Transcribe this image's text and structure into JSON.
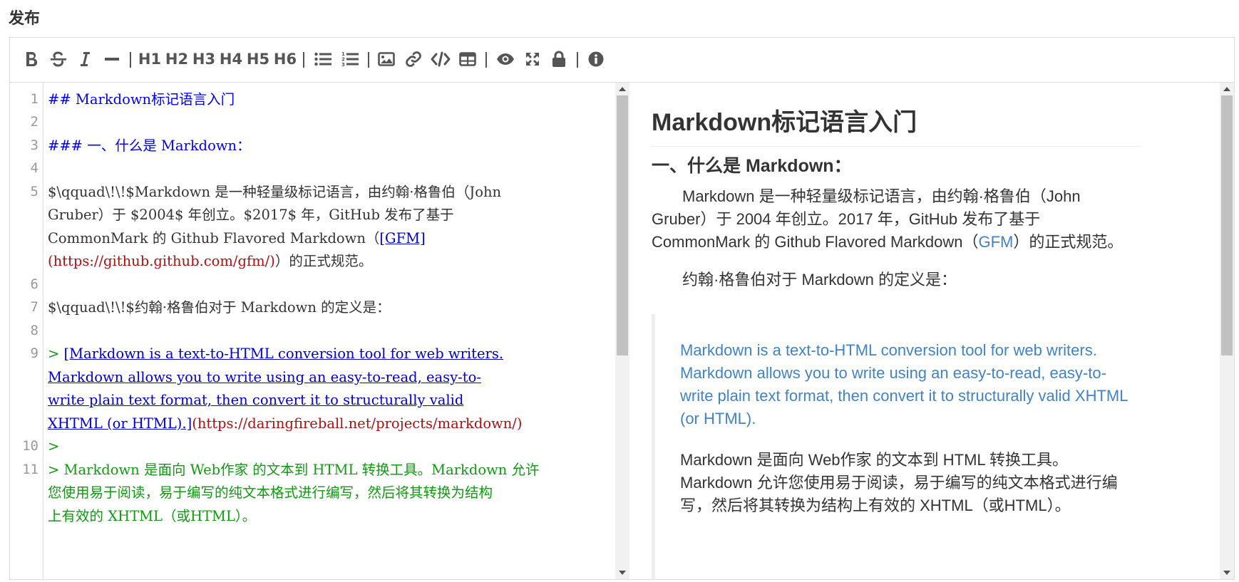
{
  "page": {
    "title": "发布"
  },
  "toolbar": {
    "headings": [
      "H1",
      "H2",
      "H3",
      "H4",
      "H5",
      "H6"
    ]
  },
  "icons": {
    "bold": "bold-icon",
    "strike": "strikethrough-icon",
    "italic": "italic-icon",
    "hr": "horizontal-rule-icon",
    "ul": "unordered-list-icon",
    "ol": "ordered-list-icon",
    "image": "image-icon",
    "link": "link-icon",
    "code": "code-icon",
    "table": "table-icon",
    "preview": "eye-icon",
    "fullscreen": "fullscreen-icon",
    "lock": "lock-icon",
    "info": "info-icon"
  },
  "code": {
    "line_numbers": [
      "1",
      "2",
      "3",
      "4",
      "5",
      "6",
      "7",
      "8",
      "9",
      "10",
      "11"
    ],
    "l1": "## Markdown标记语言入门",
    "l3": "### 一、什么是 Markdown：",
    "l5a": "$\\qquad\\!\\!$Markdown 是一种轻量级标记语言，由约翰·格鲁伯（John",
    "l5b": "Gruber）于 $2004$ 年创立。$2017$ 年，GitHub 发布了基于",
    "l5c_pre": "CommonMark 的 Github Flavored Markdown（",
    "l5c_link": "[GFM]",
    "l5d_url": "(https://github.github.com/gfm/)",
    "l5d_post": "）的正式规范。",
    "l7": "$\\qquad\\!\\!$约翰·格鲁伯对于 Markdown 的定义是：",
    "l9_prefix": "> ",
    "l9a": "[Markdown is a text-to-HTML conversion tool for web writers.",
    "l9b": "Markdown allows you to write using an easy-to-read, easy-to-",
    "l9c": "write plain text format, then convert it to structurally valid",
    "l9d_link": "XHTML (or HTML).]",
    "l9d_url": "(https://daringfireball.net/projects/markdown/)",
    "l10": ">",
    "l11a": "> Markdown 是面向 Web作家 的文本到 HTML 转换工具。Markdown 允许",
    "l11b": "您使用易于阅读，易于编写的纯文本格式进行编写，然后将其转换为结构",
    "l11c": "上有效的 XHTML（或HTML）。"
  },
  "preview": {
    "h2": "Markdown标记语言入门",
    "h3": "一、什么是 Markdown：",
    "p1a": "Markdown 是一种轻量级标记语言，由约翰·格鲁伯（John",
    "p1b": "Gruber）于 2004 年创立。2017 年，GitHub 发布了基于",
    "p1c_pre": "CommonMark 的 Github Flavored Markdown（",
    "p1c_link": "GFM",
    "p1c_post": "）的正式规范。",
    "p2": "约翰·格鲁伯对于 Markdown 的定义是：",
    "quote_link": "Markdown is a text-to-HTML conversion tool for web writers. Markdown allows you to write using an easy-to-read, easy-to-write plain text format, then convert it to structurally valid XHTML (or HTML).",
    "quote_p2": "Markdown 是面向 Web作家 的文本到 HTML 转换工具。Markdown 允许您使用易于阅读，易于编写的纯文本格式进行编写，然后将其转换为结构上有效的 XHTML（或HTML）。"
  }
}
